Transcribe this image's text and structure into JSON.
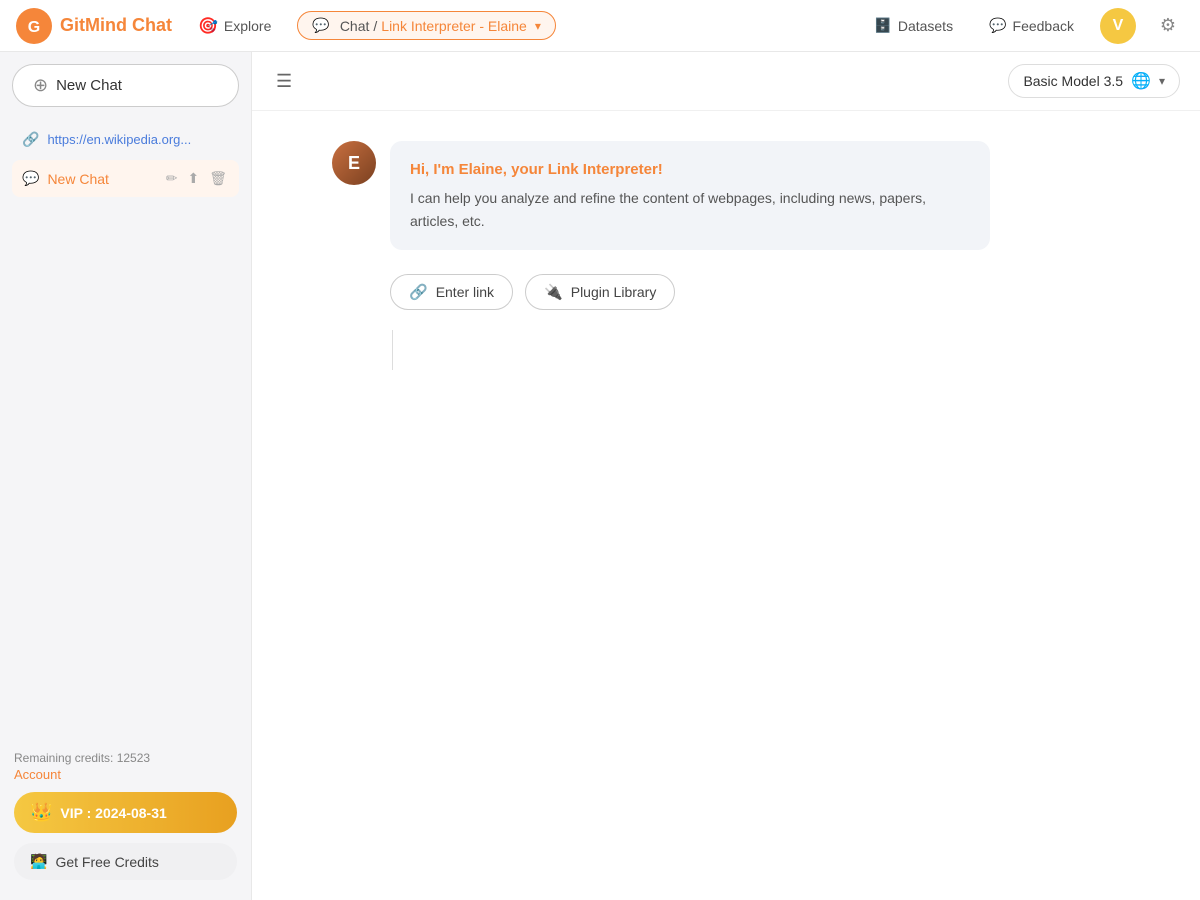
{
  "header": {
    "logo_text": "GitMind Chat",
    "explore_label": "Explore",
    "breadcrumb_chat": "Chat",
    "breadcrumb_separator": "/",
    "breadcrumb_active": "Link Interpreter - Elaine",
    "datasets_label": "Datasets",
    "feedback_label": "Feedback",
    "avatar_letter": "V",
    "model_label": "Basic Model 3.5"
  },
  "sidebar": {
    "new_chat_label": "New Chat",
    "link_item": "https://en.wikipedia.org...",
    "chat_item_label": "New Chat",
    "credits_label": "Remaining credits: 12523",
    "account_label": "Account",
    "vip_label": "VIP : 2024-08-31",
    "get_credits_label": "Get Free Credits"
  },
  "chat": {
    "greeting": "Hi, I'm Elaine, your Link Interpreter!",
    "sub_text": "I can help you analyze and refine the content of webpages, including news, papers, articles, etc.",
    "enter_link_label": "Enter link",
    "plugin_library_label": "Plugin Library"
  }
}
